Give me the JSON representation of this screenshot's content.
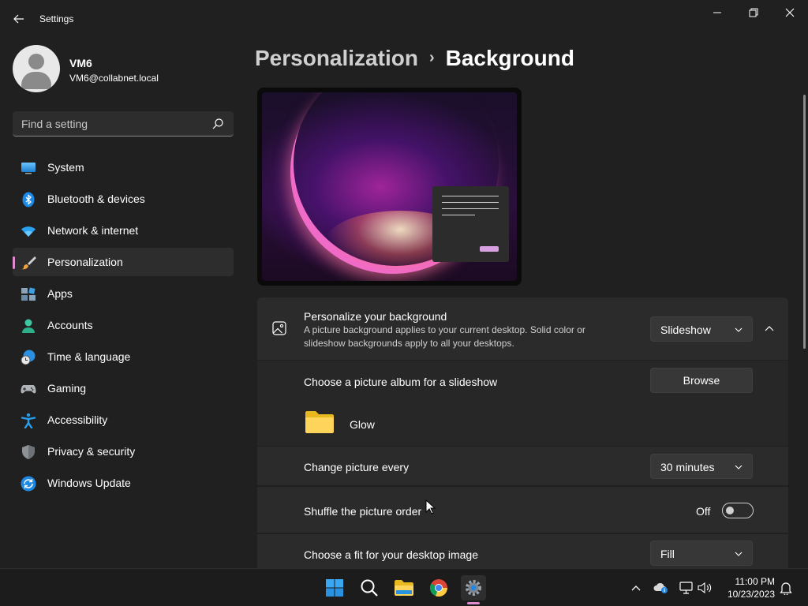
{
  "window": {
    "app_title": "Settings",
    "back_icon": "arrow-left-icon",
    "controls": [
      "minimize-icon",
      "maximize-icon",
      "close-icon"
    ]
  },
  "profile": {
    "name": "VM6",
    "email": "VM6@collabnet.local"
  },
  "search": {
    "placeholder": "Find a setting",
    "icon": "search-icon"
  },
  "sidebar": {
    "items": [
      {
        "label": "System",
        "icon": "system-icon",
        "active": false
      },
      {
        "label": "Bluetooth & devices",
        "icon": "bluetooth-icon",
        "active": false
      },
      {
        "label": "Network & internet",
        "icon": "wifi-icon",
        "active": false
      },
      {
        "label": "Personalization",
        "icon": "brush-icon",
        "active": true
      },
      {
        "label": "Apps",
        "icon": "apps-icon",
        "active": false
      },
      {
        "label": "Accounts",
        "icon": "person-icon",
        "active": false
      },
      {
        "label": "Time & language",
        "icon": "globe-clock-icon",
        "active": false
      },
      {
        "label": "Gaming",
        "icon": "gamepad-icon",
        "active": false
      },
      {
        "label": "Accessibility",
        "icon": "accessibility-icon",
        "active": false
      },
      {
        "label": "Privacy & security",
        "icon": "shield-icon",
        "active": false
      },
      {
        "label": "Windows Update",
        "icon": "update-icon",
        "active": false
      }
    ]
  },
  "breadcrumb": {
    "parent": "Personalization",
    "separator": "›",
    "current": "Background"
  },
  "background": {
    "title": "Personalize your background",
    "description": "A picture background applies to your current desktop. Solid color or slideshow backgrounds apply to all your desktops.",
    "type_value": "Slideshow",
    "album_label": "Choose a picture album for a slideshow",
    "browse_label": "Browse",
    "album_name": "Glow",
    "interval_label": "Change picture every",
    "interval_value": "30 minutes",
    "shuffle_label": "Shuffle the picture order",
    "shuffle_state": "Off",
    "fit_label": "Choose a fit for your desktop image",
    "fit_value": "Fill"
  },
  "taskbar": {
    "apps": [
      "windows-start-icon",
      "search-icon",
      "file-explorer-icon",
      "chrome-icon",
      "settings-gear-icon"
    ],
    "time": "11:00 PM",
    "date": "10/23/2023"
  },
  "colors": {
    "accent": "#e08ad0",
    "background": "#202020",
    "card": "#2b2b2b"
  }
}
